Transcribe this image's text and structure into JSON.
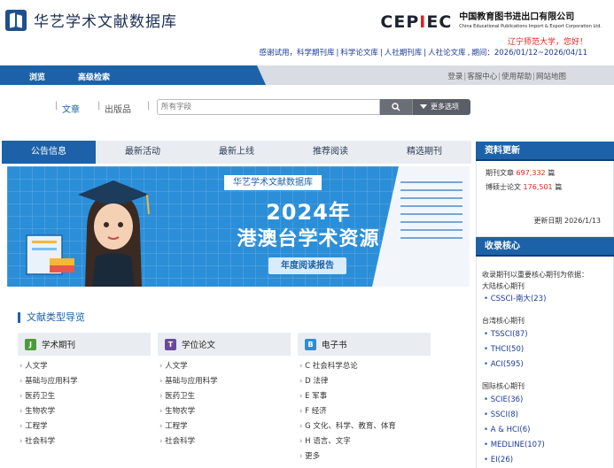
{
  "header": {
    "site_name": "华艺学术文献数据库",
    "partner_brand_left": "CEP",
    "partner_brand_red": "I",
    "partner_brand_right": "EC",
    "partner_name_cn": "中国教育图书进出口有限公司",
    "partner_name_en": "China Educational Publications Import & Export Corporation Ltd.",
    "greeting": "辽宁师范大学，您好！",
    "trial_prefix": "感谢试用，",
    "trial_links": [
      "科学期刊库",
      "科学论文库",
      "人社期刊库",
      "人社论文库"
    ],
    "trial_period": "期间：2026/01/12~2026/04/11"
  },
  "nav": {
    "browse": "浏览",
    "advanced_search": "高级检索",
    "top_links": [
      "登录",
      "客服中心",
      "使用帮助",
      "网站地图"
    ]
  },
  "search": {
    "type_article": "文章",
    "type_publication": "出版品",
    "placeholder": "所有字段",
    "more_options": "更多选项"
  },
  "tabs": [
    "公告信息",
    "最新活动",
    "最新上线",
    "推荐阅读",
    "精选期刊"
  ],
  "banner": {
    "title": "华艺学术文献数据库",
    "year": "2024年",
    "resource": "港澳台学术资源",
    "report": "年度阅读报告"
  },
  "doc_types": {
    "title": "文献类型导览",
    "categories": [
      {
        "badge": "J",
        "badge_color": "#4a9c3b",
        "name": "学术期刊",
        "items": [
          "人文学",
          "基础与应用科学",
          "医药卫生",
          "生物农学",
          "工程学",
          "社会科学"
        ]
      },
      {
        "badge": "T",
        "badge_color": "#6a4a9c",
        "name": "学位论文",
        "items": [
          "人文学",
          "基础与应用科学",
          "医药卫生",
          "生物农学",
          "工程学",
          "社会科学"
        ]
      },
      {
        "badge": "B",
        "badge_color": "#2b8ed8",
        "name": "电子书",
        "items": [
          "C 社会科学总论",
          "D 法律",
          "E 军事",
          "F 经济",
          "G 文化、科学、教育、体育",
          "H 语言、文字",
          "更多"
        ]
      }
    ]
  },
  "updates": {
    "title": "资料更新",
    "journal_label": "期刊文章",
    "journal_count": "697,332",
    "journal_unit": "篇",
    "thesis_label": "博硕士论文",
    "thesis_count": "176,501",
    "thesis_unit": "篇",
    "update_date": "更新日期 2026/1/13"
  },
  "core": {
    "title": "收录核心",
    "description": "收录期刊以重要核心期刊为依据：",
    "groups": [
      {
        "label": "大陆核心期刊",
        "items": [
          "CSSCI-南大(23)"
        ]
      },
      {
        "label": "台湾核心期刊",
        "items": [
          "TSSCI(87)",
          "THCI(50)",
          "ACI(595)"
        ]
      },
      {
        "label": "国际核心期刊",
        "items": [
          "SCIE(36)",
          "SSCI(8)",
          "A & HCI(6)",
          "MEDLINE(107)",
          "EI(26)"
        ]
      }
    ]
  },
  "colors": {
    "brand_blue": "#1d62a8",
    "accent_red": "#e0231c",
    "link_blue": "#1a3b9a"
  }
}
